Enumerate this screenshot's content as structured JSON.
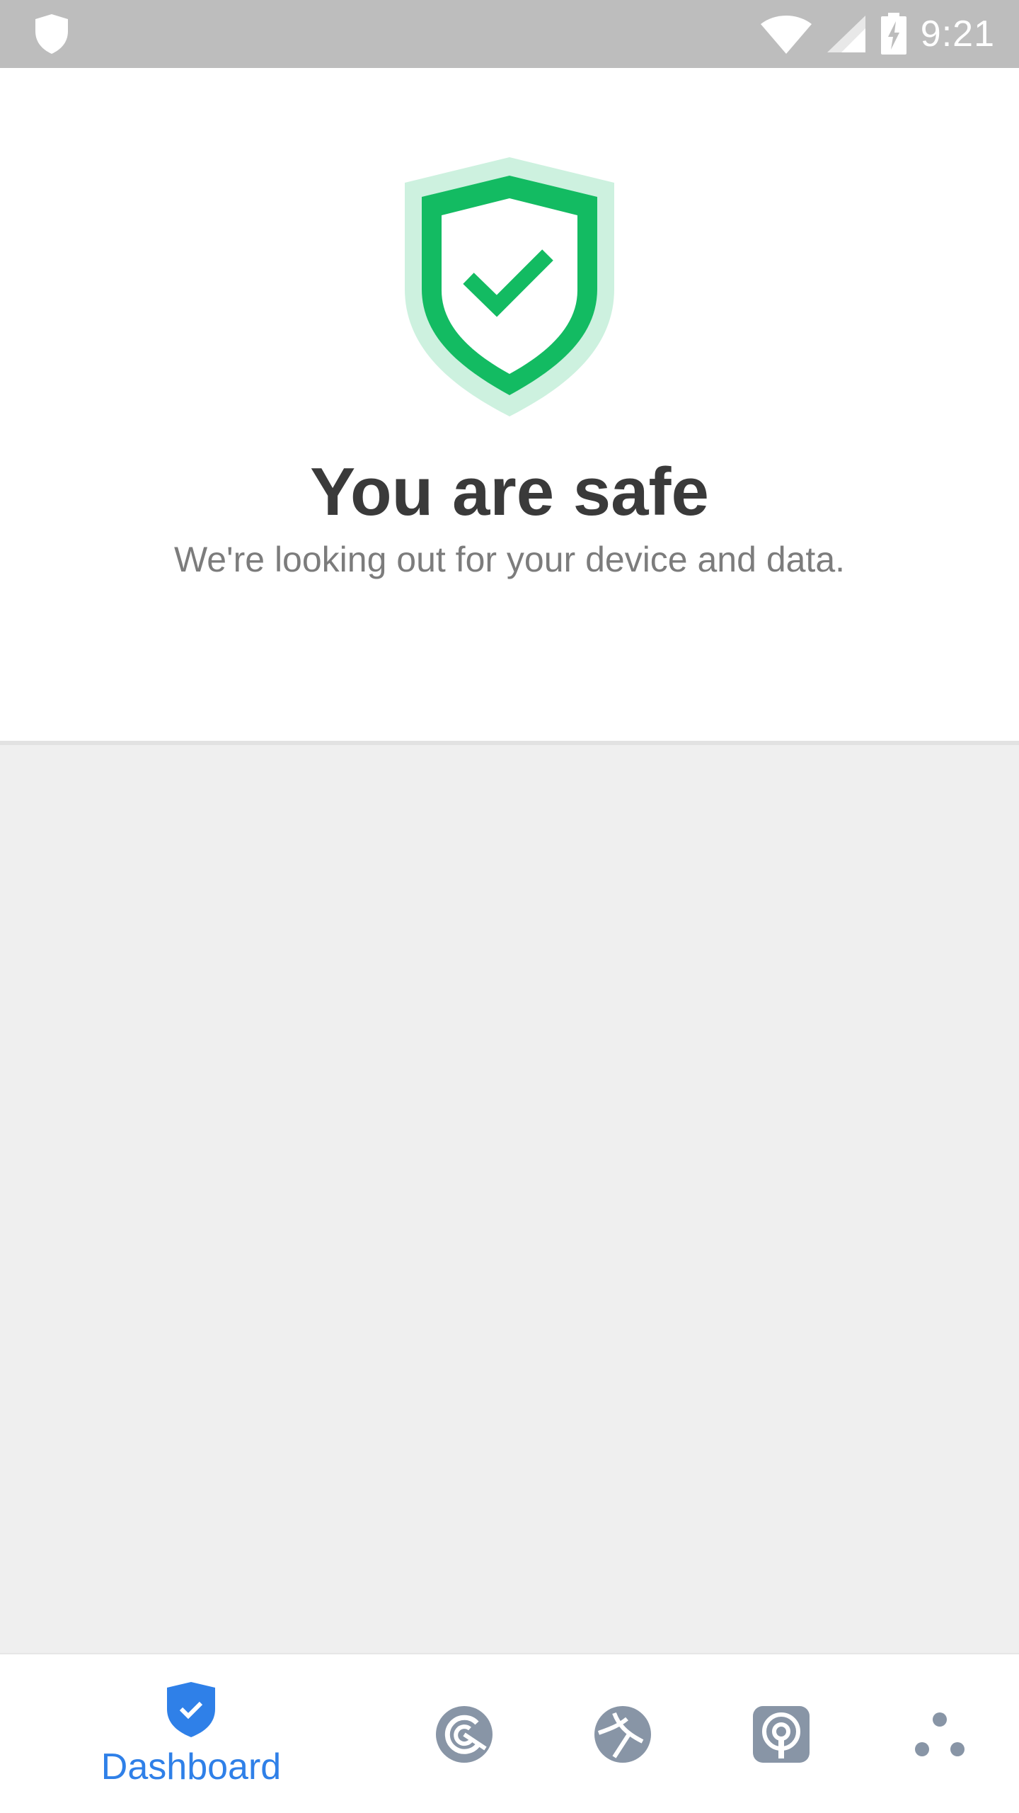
{
  "status_bar": {
    "time": "9:21",
    "icons": [
      "shield-icon",
      "wifi-icon",
      "cell-signal-icon",
      "battery-charging-icon"
    ]
  },
  "hero": {
    "icon": "shield-check-icon",
    "title": "You are safe",
    "subtitle": "We're looking out for your device and data."
  },
  "bottom_nav": {
    "items": [
      {
        "label": "Dashboard",
        "icon": "shield-check-icon",
        "active": true
      },
      {
        "label": "",
        "icon": "speed-gauge-icon",
        "active": false
      },
      {
        "label": "",
        "icon": "browser-globe-icon",
        "active": false
      },
      {
        "label": "",
        "icon": "privacy-lock-icon",
        "active": false
      },
      {
        "label": "",
        "icon": "more-dots-icon",
        "active": false
      }
    ]
  },
  "colors": {
    "accent": "#2f80e8",
    "safe_green": "#13bb62",
    "safe_green_light": "#cdf1df",
    "nav_icon_gray": "#8895a6",
    "status_bar": "#bdbdbd",
    "background": "#efefef"
  }
}
